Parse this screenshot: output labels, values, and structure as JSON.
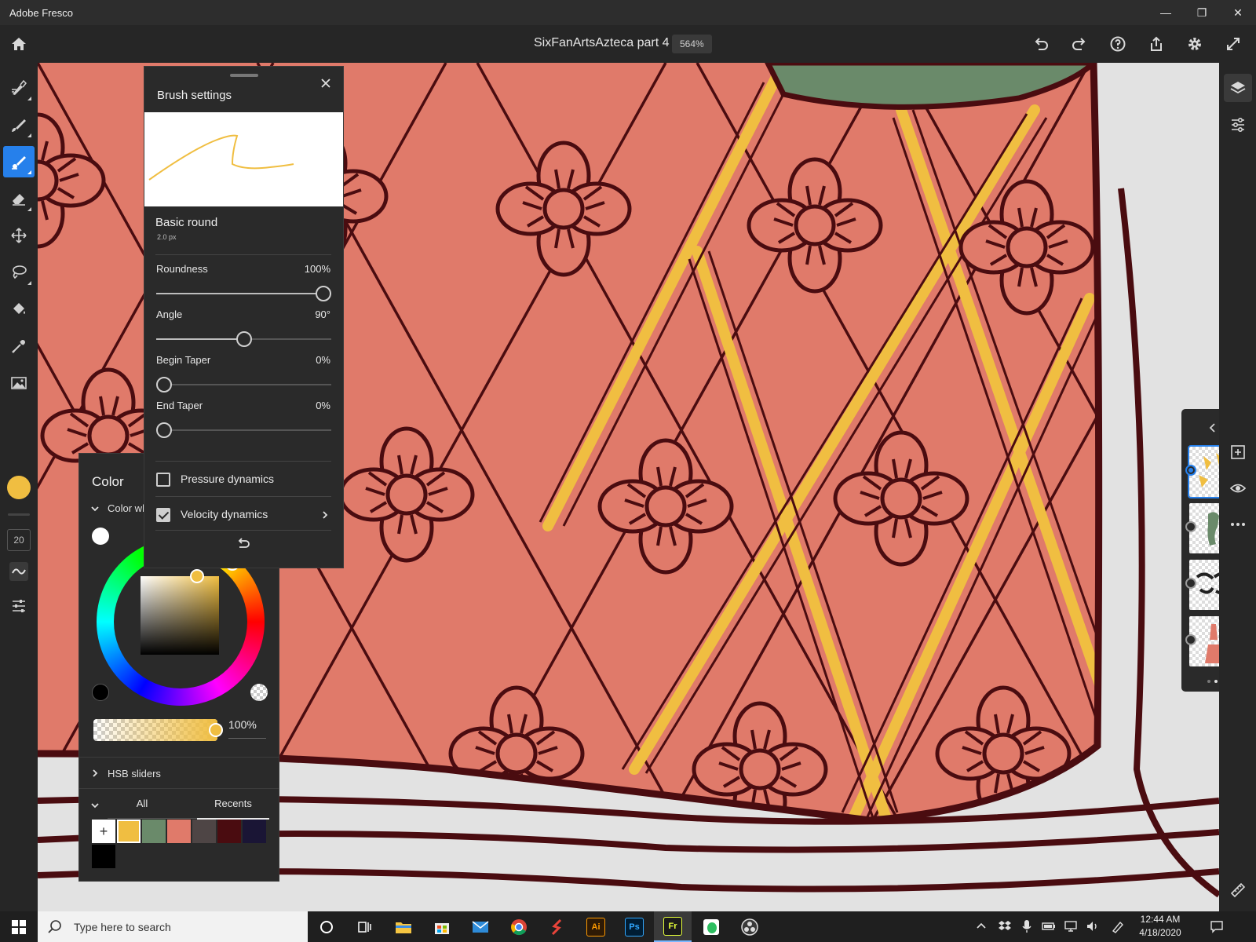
{
  "window": {
    "app_title": "Adobe Fresco",
    "minimize": "—",
    "maximize": "❐",
    "close": "✕"
  },
  "header": {
    "doc_title": "SixFanArtsAzteca part 4",
    "zoom": "564%"
  },
  "toolbar": {
    "brush_size": "20"
  },
  "brush_settings": {
    "title": "Brush settings",
    "brush_name": "Basic round",
    "brush_size": "2.0 px",
    "sliders": [
      {
        "label": "Roundness",
        "value": "100%",
        "fraction": 1.0
      },
      {
        "label": "Angle",
        "value": "90°",
        "fraction": 0.5
      },
      {
        "label": "Begin Taper",
        "value": "0%",
        "fraction": 0.0
      },
      {
        "label": "End Taper",
        "value": "0%",
        "fraction": 0.0
      }
    ],
    "pressure_label": "Pressure dynamics",
    "pressure_checked": false,
    "velocity_label": "Velocity dynamics",
    "velocity_checked": true
  },
  "color_panel": {
    "title": "Color",
    "wheel_section": "Color wheel",
    "opacity": "100%",
    "hsb_label": "HSB sliders",
    "tab_all": "All",
    "tab_recents": "Recents",
    "active_tab": "Recents",
    "current_color": "#f0be41",
    "swatches": [
      "#f0be41",
      "#6a8a6a",
      "#e07a6a",
      "#4e4545",
      "#4a0c10",
      "#1a1535",
      "#000000"
    ]
  },
  "layers": {
    "count": 4,
    "selected_index": 0,
    "pages": 2,
    "active_page": 1
  },
  "taskbar": {
    "search_placeholder": "Type here to search",
    "time": "12:44 AM",
    "date": "4/18/2020",
    "apps": [
      "cortana-icon",
      "task-view-icon",
      "file-explorer-icon",
      "store-icon",
      "mail-icon",
      "chrome-icon",
      "tool-s-icon",
      "illustrator-icon",
      "photoshop-icon",
      "fresco-icon",
      "evernote-icon",
      "obs-icon"
    ],
    "app_labels": {
      "illustrator": "Ai",
      "photoshop": "Ps",
      "fresco": "Fr"
    }
  }
}
